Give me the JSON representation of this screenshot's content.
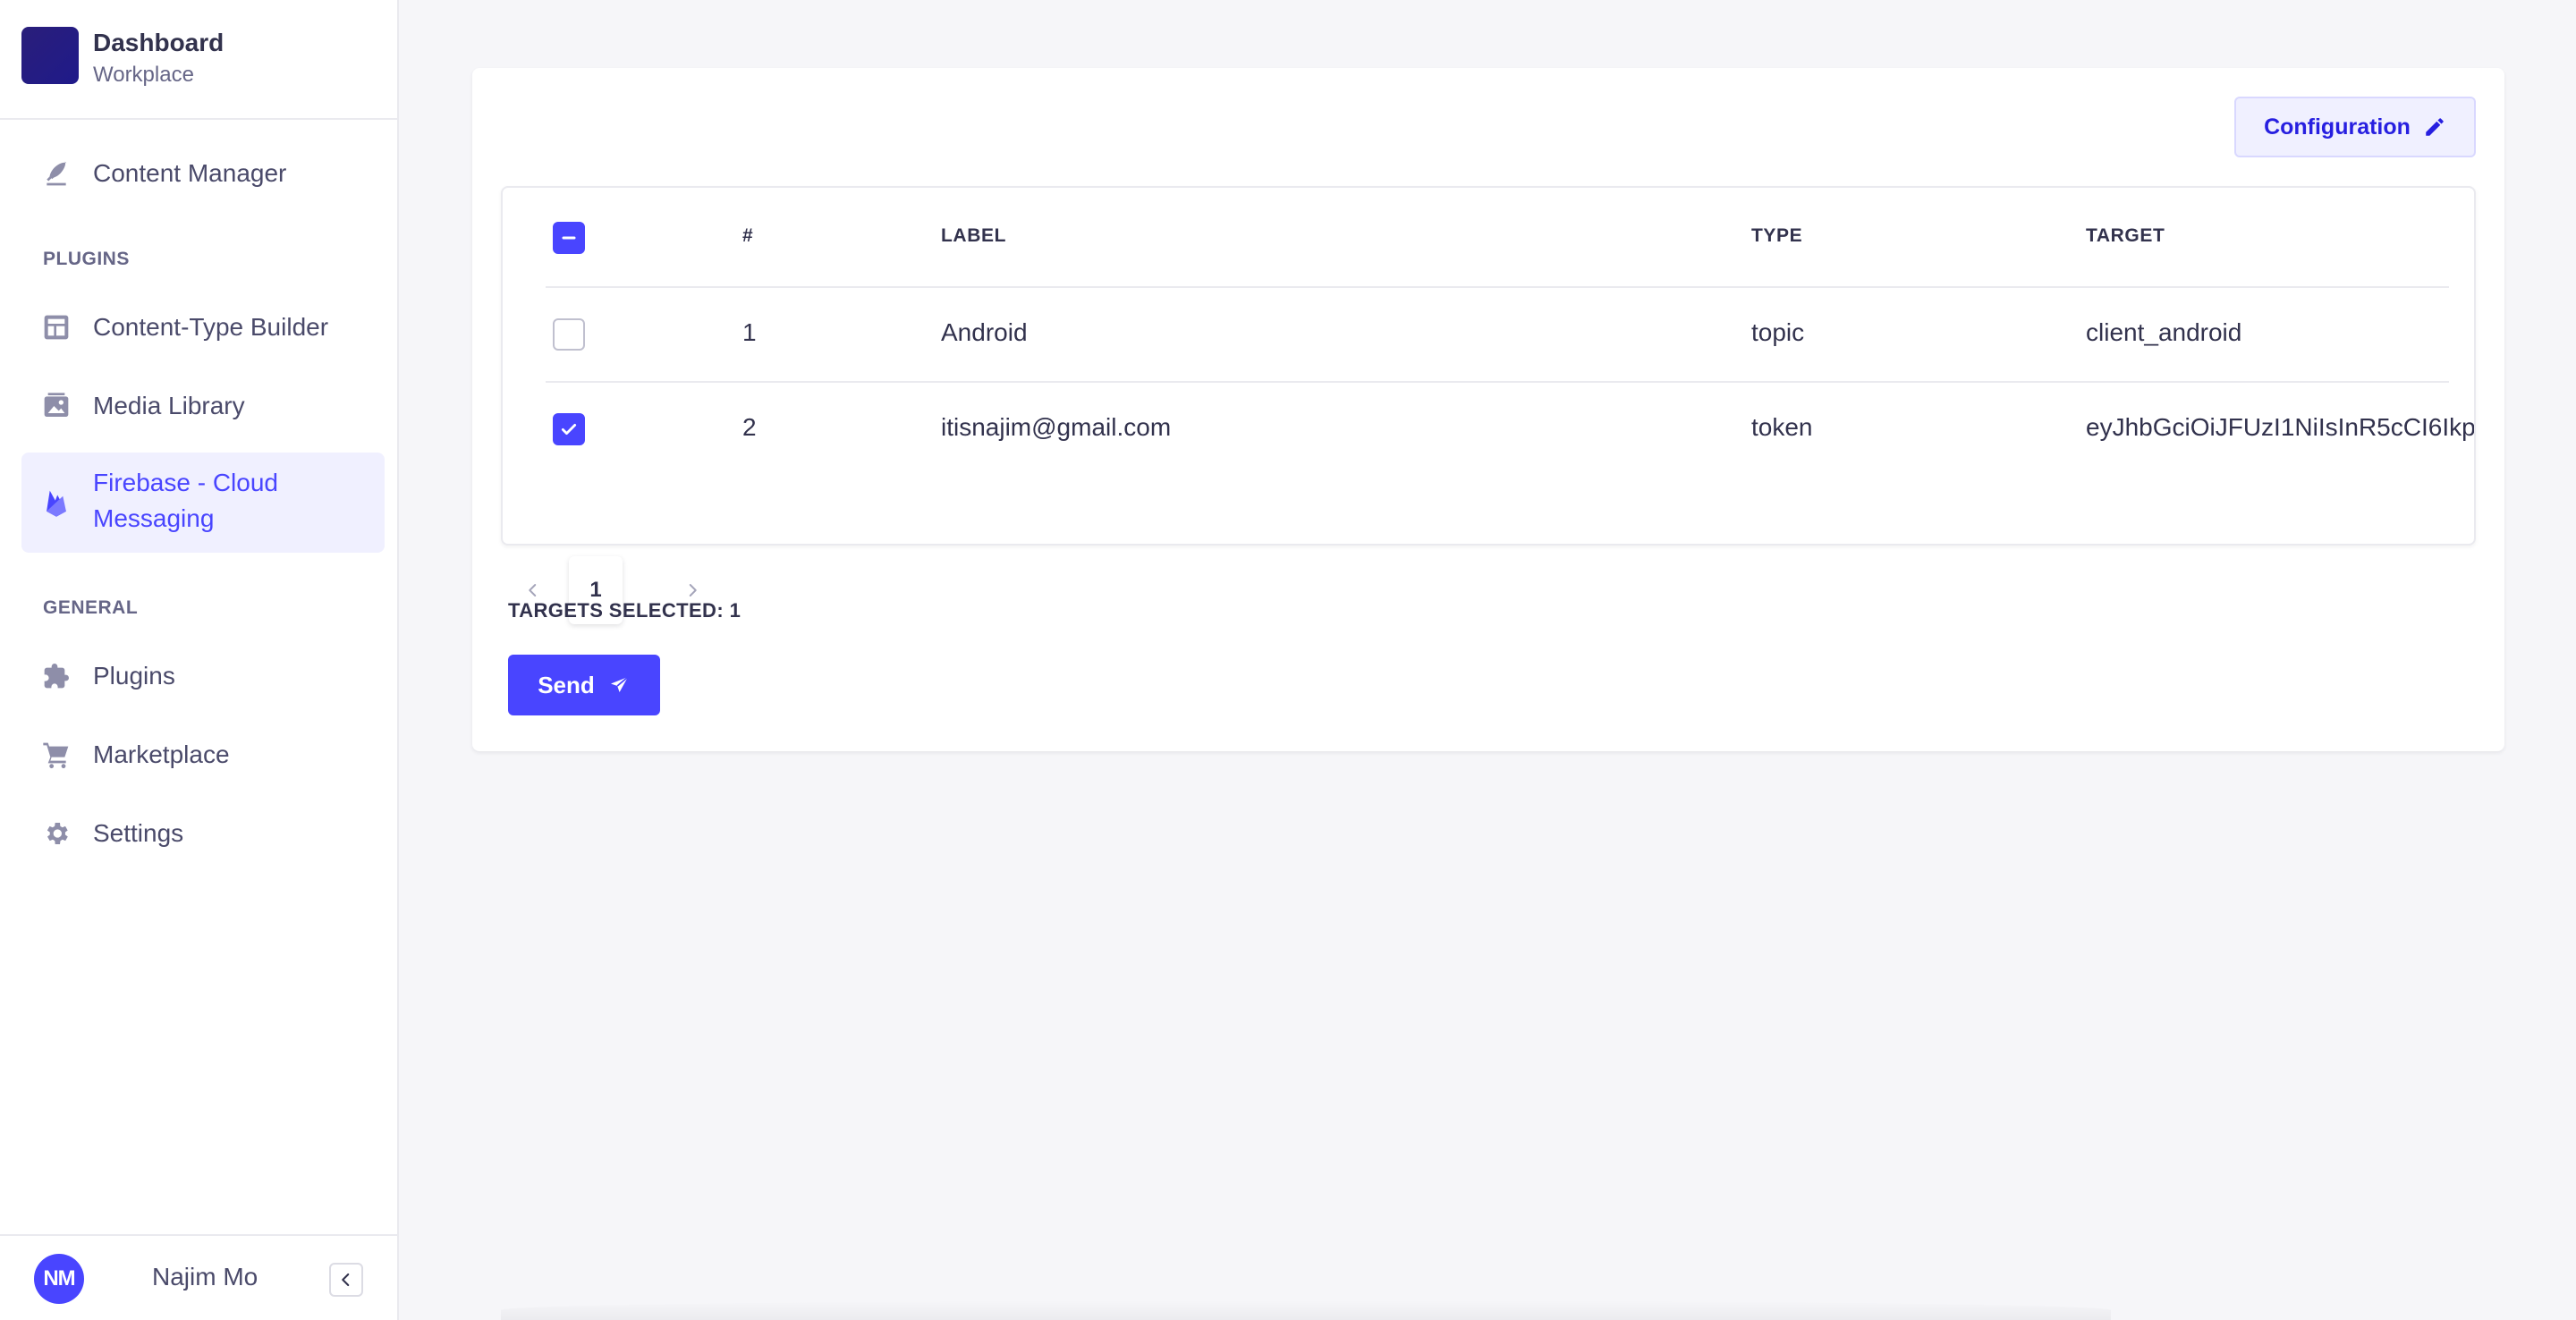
{
  "brand": {
    "title": "Dashboard",
    "subtitle": "Workplace"
  },
  "sidebar": {
    "content_manager": {
      "label": "Content Manager",
      "icon": "feather-icon"
    },
    "plugins_section": "PLUGINS",
    "plugins": [
      {
        "label": "Content-Type Builder",
        "icon": "layout-icon"
      },
      {
        "label": "Media Library",
        "icon": "image-icon"
      },
      {
        "label": "Firebase - Cloud\nMessaging",
        "label_line1": "Firebase - Cloud",
        "label_line2": "Messaging",
        "icon": "firebase-icon",
        "active": true
      }
    ],
    "general_section": "GENERAL",
    "general": [
      {
        "label": "Plugins",
        "icon": "puzzle-icon"
      },
      {
        "label": "Marketplace",
        "icon": "cart-icon"
      },
      {
        "label": "Settings",
        "icon": "gear-icon"
      }
    ],
    "user": {
      "initials": "NM",
      "name": "Najim Mo"
    }
  },
  "main": {
    "config_button": "Configuration",
    "table": {
      "headers": {
        "num": "#",
        "label": "LABEL",
        "type": "TYPE",
        "target": "TARGET"
      },
      "rows": [
        {
          "num": "1",
          "label": "Android",
          "type": "topic",
          "target": "client_android",
          "checked": false
        },
        {
          "num": "2",
          "label": "itisnajim@gmail.com",
          "type": "token",
          "target": "eyJhbGciOiJFUzI1NiIsInR5cCI6Ikp",
          "checked": true
        }
      ]
    },
    "pagination": {
      "current_page": "1"
    },
    "targets_selected": "TARGETS SELECTED: 1",
    "send_button": "Send"
  },
  "colors": {
    "accent": "#4945ff",
    "accent_dark": "#271fe0",
    "active_bg": "#f0f0ff",
    "page_bg": "#f6f6f9"
  }
}
